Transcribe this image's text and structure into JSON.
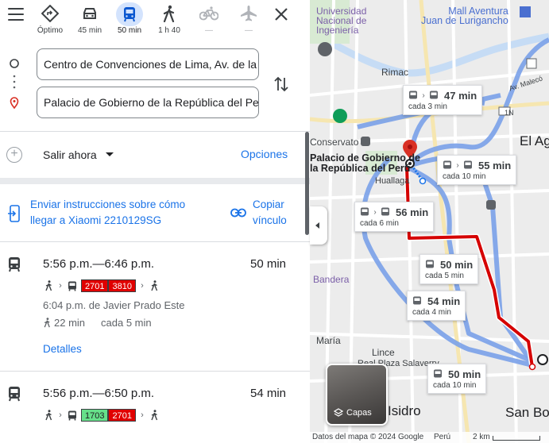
{
  "modes": [
    {
      "name": "Óptimo",
      "label": "Óptimo",
      "icon": "best-route-icon"
    },
    {
      "name": "car",
      "label": "45 min",
      "icon": "car-icon"
    },
    {
      "name": "transit",
      "label": "50 min",
      "icon": "transit-icon",
      "selected": true
    },
    {
      "name": "walk",
      "label": "1 h 40",
      "icon": "walk-icon"
    },
    {
      "name": "bike",
      "label": "—",
      "icon": "bike-icon",
      "disabled": true
    },
    {
      "name": "flight",
      "label": "—",
      "icon": "flight-icon",
      "disabled": true
    }
  ],
  "origin": {
    "value": "Centro de Convenciones de Lima, Av. de la"
  },
  "destination": {
    "value": "Palacio de Gobierno de la República del Pe"
  },
  "leave": {
    "label": "Salir ahora"
  },
  "options_label": "Opciones",
  "send": {
    "text": "Enviar instrucciones sobre cómo llegar a Xiaomi 2210129SG"
  },
  "copy": {
    "text": "Copiar vínculo"
  },
  "routes": [
    {
      "times": "5:56 p.m.—6:46 p.m.",
      "duration": "50 min",
      "badges": [
        {
          "text": "2701",
          "bg": "#e00000",
          "fg": "#ffffff"
        },
        {
          "text": "3810",
          "bg": "#e00000",
          "fg": "#ffffff"
        }
      ],
      "depart": "6:04 p.m. de Javier Prado Este",
      "walk": "22 min",
      "frequency": "cada 5 min",
      "details_label": "Detalles"
    },
    {
      "times": "5:56 p.m.—6:50 p.m.",
      "duration": "54 min",
      "badges": [
        {
          "text": "1703",
          "bg": "#66e08a",
          "fg": "#202124"
        },
        {
          "text": "2701",
          "bg": "#e00000",
          "fg": "#ffffff"
        }
      ]
    }
  ],
  "map": {
    "labels": {
      "univ": "Universidad\nNacional de\nIngeniería",
      "mall": "Mall Aventura\nJuan de Lurigancho",
      "rimac": "Rimac",
      "conservatorio": "Conservato",
      "palacio": "Palacio de Gobierno de\nla República del Perú",
      "huallaga": "Huallaga",
      "el_agustino": "El Ag",
      "bandera": "Bandera",
      "maria": "María",
      "lince": "Lince",
      "real_plaza": "Real Plaza Salaverry",
      "isidro": "Isidro",
      "san_borja": "San Bo",
      "av_malecon": "Av. Malecó",
      "av_1n": "1N",
      "p_label": "P"
    },
    "bubbles": [
      {
        "time": "47 min",
        "freq": "cada 3 min",
        "double": true
      },
      {
        "time": "55 min",
        "freq": "cada 10 min",
        "double": true
      },
      {
        "time": "56 min",
        "freq": "cada 6 min",
        "double": true
      },
      {
        "time": "50 min",
        "freq": "cada 5 min",
        "double": false
      },
      {
        "time": "54 min",
        "freq": "cada 4 min",
        "double": false
      },
      {
        "time": "50 min",
        "freq": "cada 10 min",
        "double": false
      }
    ],
    "layers_label": "Capas",
    "footer": {
      "data": "Datos del mapa © 2024 Google",
      "region": "Perú",
      "scale": "2 km"
    }
  },
  "colors": {
    "accent": "#1a73e8",
    "route": "#d50000",
    "alt_route": "#7aa1e9"
  }
}
